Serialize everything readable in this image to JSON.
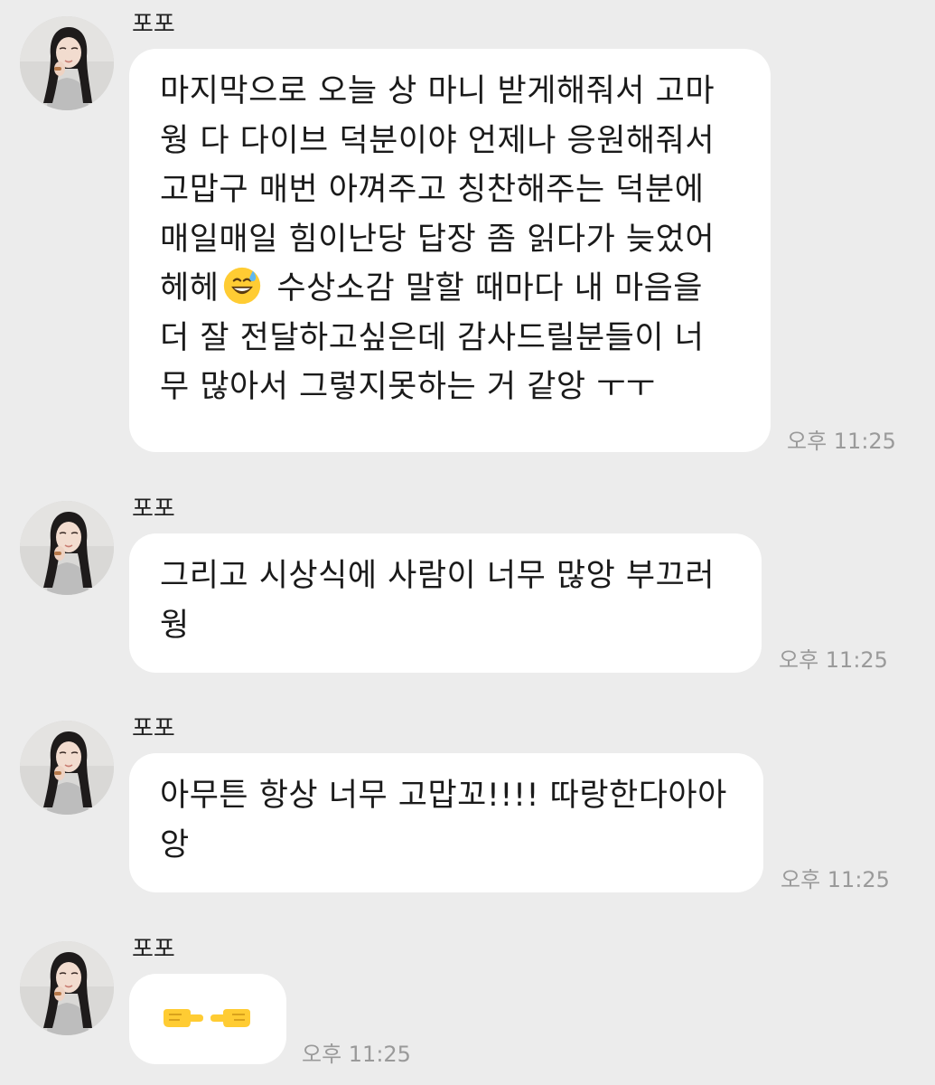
{
  "messages": [
    {
      "sender": "포포",
      "lines": [
        "마지막으로 오늘 상 마니 받게해줘서 고마",
        "웡 다 다이브 덕분이야 언제나 응원해줘서",
        "고맙구 매번 아껴주고 칭찬해주는 덕분에",
        "매일매일 힘이난당 답장 좀 읽다가 늦었어",
        "헤헤",
        "수상소감 말할 때마다 내 마음을",
        "더 잘 전달하고싶은데 감사드릴분들이 너",
        "무 많아서 그렇지못하는 거 같앙 ㅜㅜ"
      ],
      "inline_emoji": "grinning-face-with-sweat-emoji",
      "time": "오후 11:25"
    },
    {
      "sender": "포포",
      "lines": [
        "그리고 시상식에 사람이 너무 많앙 부끄러",
        "웡"
      ],
      "time": "오후 11:25"
    },
    {
      "sender": "포포",
      "lines": [
        "아무튼 항상 너무 고맙꼬!!!! 따랑한다아아",
        "앙"
      ],
      "time": "오후 11:25"
    },
    {
      "sender": "포포",
      "emojis": [
        "backhand-index-pointing-right-emoji",
        "backhand-index-pointing-left-emoji"
      ],
      "time": "오후 11:25"
    }
  ],
  "colors": {
    "background": "#ececec",
    "bubble": "#ffffff",
    "text": "#1a1a1a",
    "time": "#9a9a9a"
  }
}
